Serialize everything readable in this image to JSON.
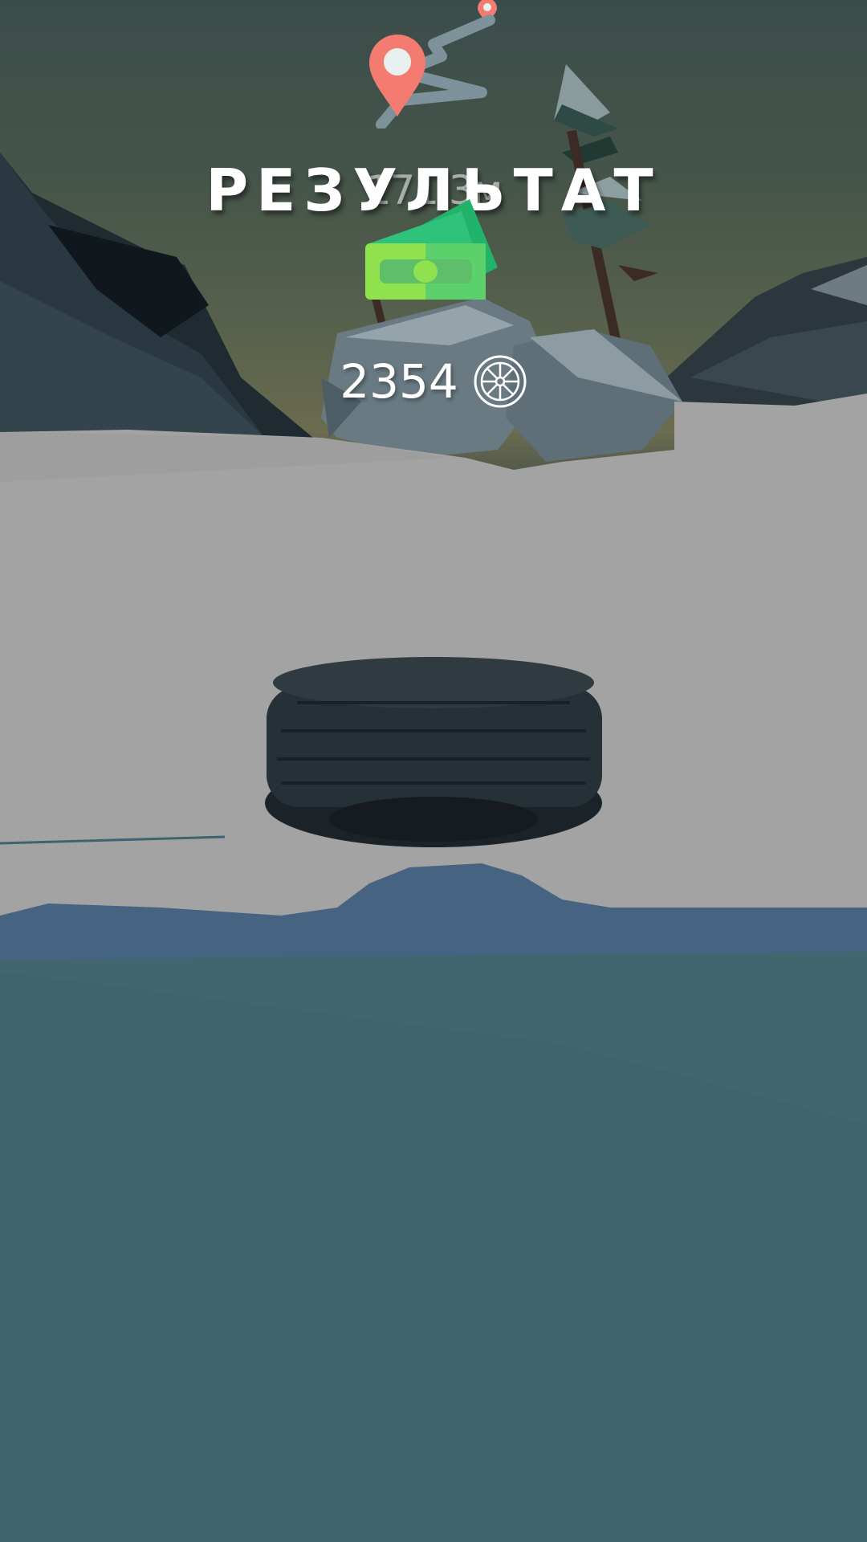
{
  "result": {
    "title": "РЕЗУЛЬТАТ",
    "distance": "171.3м",
    "score": "2354"
  },
  "icons": {
    "route": "map-pin-route-icon",
    "money": "money-icon",
    "wheel": "wheel-rim-icon"
  },
  "colors": {
    "pin": "#f47b70",
    "money_light": "#8fe14d",
    "money_dark": "#22b36b",
    "snow": "#a3a3a3",
    "water": "#3f636f"
  }
}
